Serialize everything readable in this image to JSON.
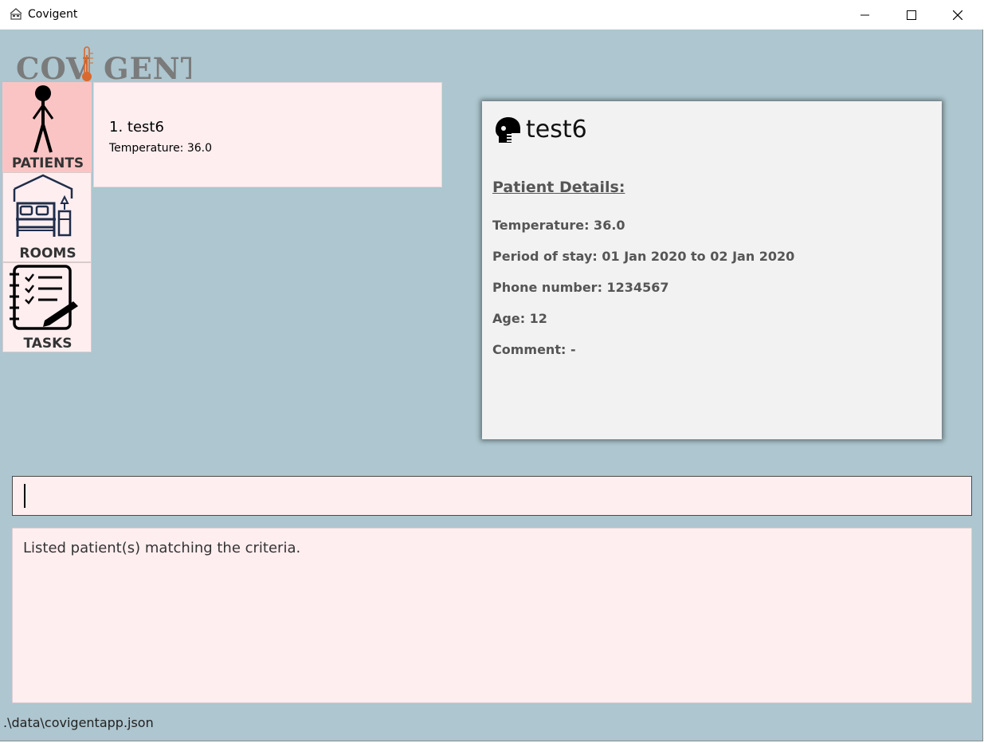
{
  "window": {
    "title": "Covigent"
  },
  "logo": {
    "text": "COVIGENT"
  },
  "nav": {
    "patients_label": "PATIENTS",
    "rooms_label": "ROOMS",
    "tasks_label": "TASKS",
    "active": "patients",
    "active_color": "#fbc4c4"
  },
  "patient_list": [
    {
      "index_name": "1.  test6",
      "temperature": "Temperature: 36.0"
    }
  ],
  "detail": {
    "name": "test6",
    "heading": "Patient Details:",
    "temperature": "Temperature: 36.0",
    "period": "Period of stay: 01 Jan 2020 to 02 Jan 2020",
    "phone": "Phone number: 1234567",
    "age": "Age: 12",
    "comment": "Comment: -"
  },
  "command": {
    "value": ""
  },
  "result": {
    "text": "Listed patient(s) matching the criteria."
  },
  "status": {
    "file_path": ".\\data\\covigentapp.json"
  },
  "colors": {
    "background": "#adc6cf",
    "card": "#ffeef0",
    "detail_panel": "#f2f2f2",
    "logo": "#7b7b7b",
    "thermometer": "#d9692e"
  }
}
